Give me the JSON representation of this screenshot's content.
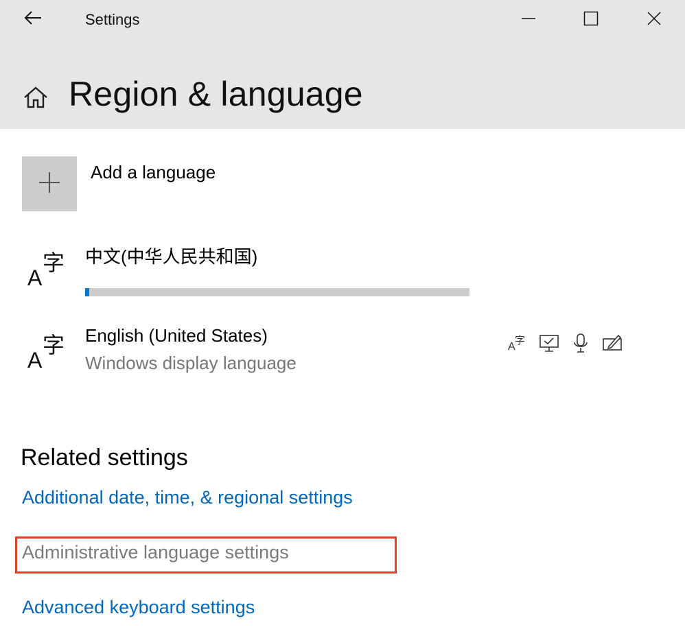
{
  "window": {
    "title": "Settings",
    "back_icon": "back-arrow-icon",
    "minimize_icon": "minimize-icon",
    "maximize_icon": "maximize-icon",
    "close_icon": "close-icon"
  },
  "header": {
    "home_icon": "home-icon",
    "page_title": "Region & language"
  },
  "languages": {
    "add_label": "Add a language",
    "add_icon": "plus-icon",
    "items": [
      {
        "name": "中文(中华人民共和国)",
        "icon": "language-icon",
        "download_progress": 0.01
      },
      {
        "name": "English (United States)",
        "subtitle": "Windows display language",
        "icon": "language-icon",
        "features": [
          "language-pack-icon",
          "display-language-icon",
          "speech-icon",
          "handwriting-icon"
        ]
      }
    ]
  },
  "related": {
    "title": "Related settings",
    "links": [
      {
        "label": "Additional date, time, & regional settings",
        "enabled": true
      },
      {
        "label": "Administrative language settings",
        "enabled": false,
        "highlighted": true
      },
      {
        "label": "Advanced keyboard settings",
        "enabled": true
      }
    ]
  },
  "colors": {
    "link": "#0067c0",
    "accent": "#0078d7",
    "titlebar_bg": "#e6e6e6",
    "highlight_border": "#e0412b"
  }
}
